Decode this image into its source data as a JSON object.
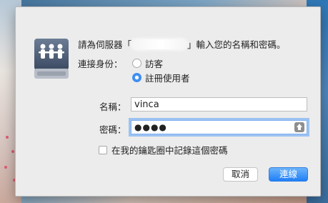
{
  "dialog": {
    "prompt": {
      "before": "請為伺服器「",
      "after": "」輸入您的名稱和密碼。"
    },
    "connect_as": {
      "label": "連接身份：",
      "options": [
        {
          "label": "訪客",
          "selected": false
        },
        {
          "label": "註冊使用者",
          "selected": true
        }
      ]
    },
    "name_field": {
      "label": "名稱：",
      "value": "vinca"
    },
    "password_field": {
      "label": "密碼：",
      "masked_value": "●●●●"
    },
    "remember_checkbox": {
      "label": "在我的鑰匙圈中記錄這個密碼",
      "checked": false
    },
    "buttons": {
      "cancel": "取消",
      "connect": "連線"
    },
    "icons": {
      "server": "server-icon",
      "password_key": "key-icon"
    },
    "colors": {
      "accent": "#2f83f5"
    }
  }
}
